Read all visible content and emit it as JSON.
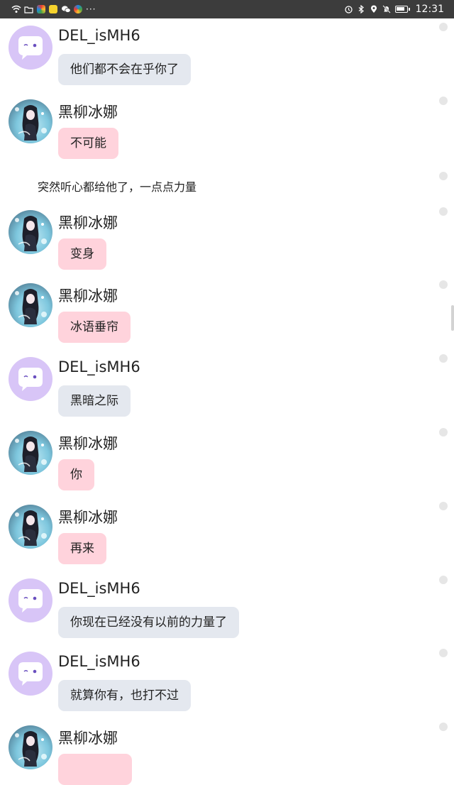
{
  "status_bar": {
    "time": "12:31",
    "overflow": "···"
  },
  "messages": [
    {
      "type": "chat",
      "name": "DEL_isMH6",
      "avatar": "bot-face",
      "bubble": "grey",
      "text": "他们都不会在乎你了"
    },
    {
      "type": "chat",
      "name": "黑柳冰娜",
      "avatar": "anime-girl",
      "bubble": "pink",
      "text": "不可能"
    },
    {
      "type": "narration",
      "text": "突然听心都给他了，一点点力量"
    },
    {
      "type": "chat",
      "name": "黑柳冰娜",
      "avatar": "anime-girl",
      "bubble": "pink",
      "text": "变身"
    },
    {
      "type": "chat",
      "name": "黑柳冰娜",
      "avatar": "anime-girl",
      "bubble": "pink",
      "text": "冰语垂帘"
    },
    {
      "type": "chat",
      "name": "DEL_isMH6",
      "avatar": "bot-face",
      "bubble": "grey",
      "text": "黑暗之际"
    },
    {
      "type": "chat",
      "name": "黑柳冰娜",
      "avatar": "anime-girl",
      "bubble": "pink",
      "text": "你"
    },
    {
      "type": "chat",
      "name": "黑柳冰娜",
      "avatar": "anime-girl",
      "bubble": "pink",
      "text": "再来"
    },
    {
      "type": "chat",
      "name": "DEL_isMH6",
      "avatar": "bot-face",
      "bubble": "grey",
      "text": "你现在已经没有以前的力量了"
    },
    {
      "type": "chat",
      "name": "DEL_isMH6",
      "avatar": "bot-face",
      "bubble": "grey",
      "text": "就算你有，也打不过"
    },
    {
      "type": "chat",
      "name": "黑柳冰娜",
      "avatar": "anime-girl",
      "bubble": "pink",
      "text": ""
    }
  ],
  "colors": {
    "bubble_grey": "#e4e8ef",
    "bubble_pink": "#ffd3dc",
    "bot_avatar": "#d8c5f7",
    "status_bar": "#3c3c3c"
  }
}
